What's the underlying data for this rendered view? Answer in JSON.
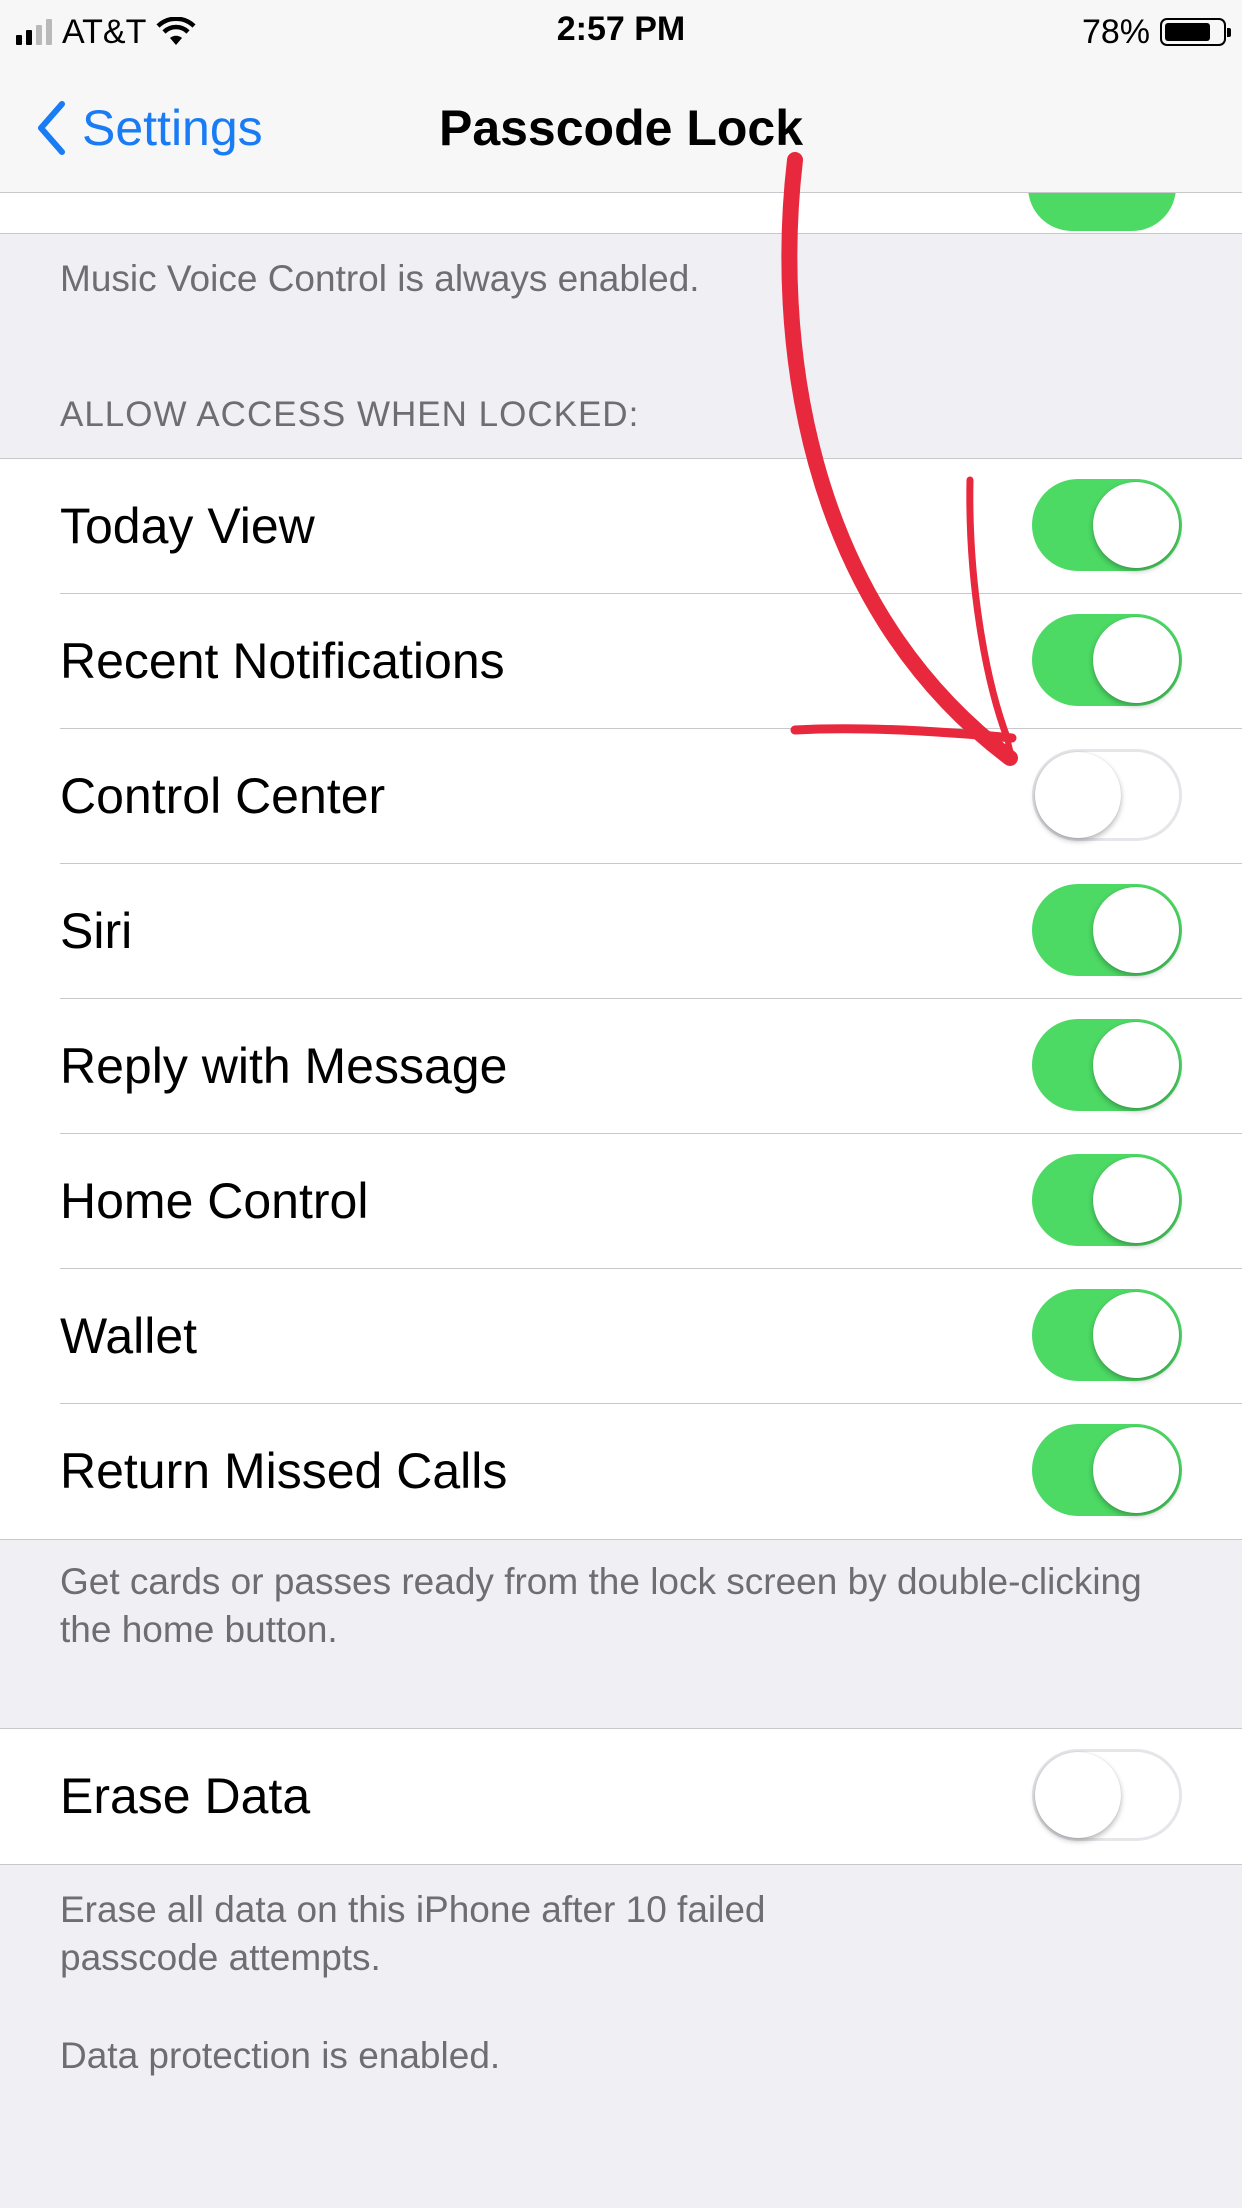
{
  "status_bar": {
    "carrier": "AT&T",
    "time": "2:57 PM",
    "battery_percent": "78%",
    "battery_level": 0.78,
    "signal_bars": 2
  },
  "nav": {
    "back_label": "Settings",
    "title": "Passcode Lock"
  },
  "voice_note": "Music Voice Control is always enabled.",
  "section_header": "ALLOW ACCESS WHEN LOCKED:",
  "access_items": [
    {
      "label": "Today View",
      "on": true
    },
    {
      "label": "Recent Notifications",
      "on": true
    },
    {
      "label": "Control Center",
      "on": false
    },
    {
      "label": "Siri",
      "on": true
    },
    {
      "label": "Reply with Message",
      "on": true
    },
    {
      "label": "Home Control",
      "on": true
    },
    {
      "label": "Wallet",
      "on": true
    },
    {
      "label": "Return Missed Calls",
      "on": true
    }
  ],
  "wallet_note": "Get cards or passes ready from the lock screen by double-clicking the home button.",
  "erase": {
    "label": "Erase Data",
    "on": false
  },
  "erase_note": "Erase all data on this iPhone after 10 failed passcode attempts.",
  "protection_note": "Data protection is enabled.",
  "colors": {
    "accent": "#1a7cf5",
    "toggle_on": "#4cd964",
    "annotation": "#e8283d",
    "background": "#efeff4"
  }
}
